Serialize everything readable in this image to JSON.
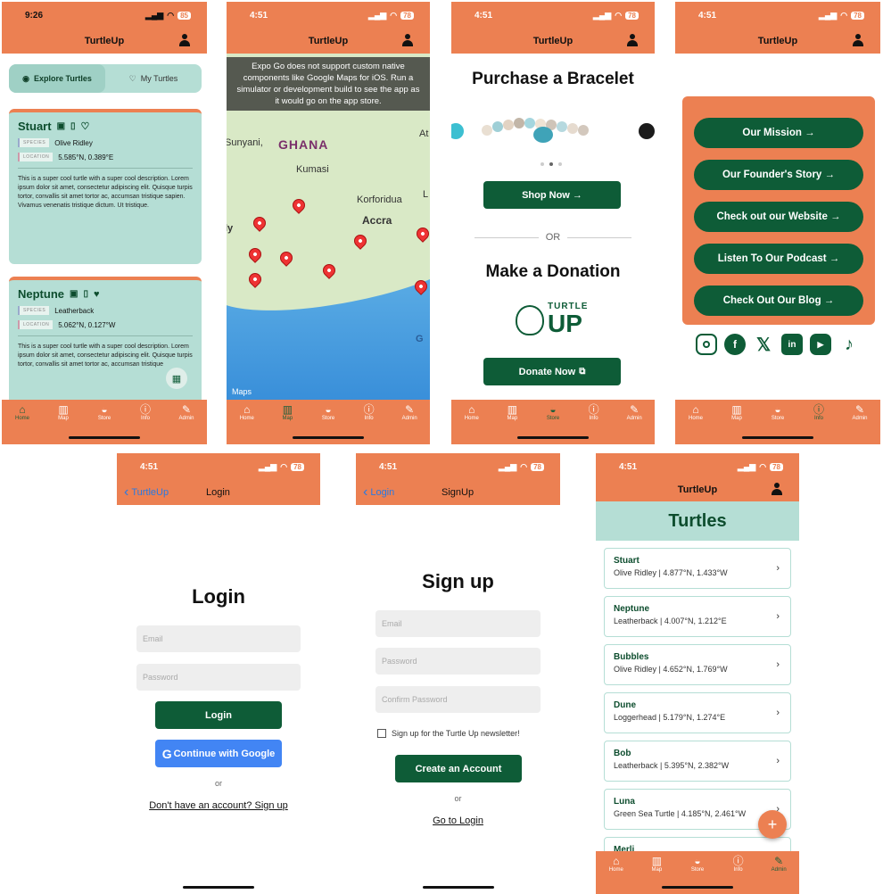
{
  "colors": {
    "primary_orange": "#EC8052",
    "dark_green": "#0E5C37",
    "mint": "#B5DED5",
    "google_blue": "#4285F4"
  },
  "tabs": [
    {
      "label": "Home",
      "icon": "home-icon"
    },
    {
      "label": "Map",
      "icon": "map-icon"
    },
    {
      "label": "Store",
      "icon": "basket-icon"
    },
    {
      "label": "Info",
      "icon": "info-icon"
    },
    {
      "label": "Admin",
      "icon": "wrench-icon"
    }
  ],
  "phone1": {
    "time": "9:26",
    "battery": "85",
    "title": "TurtleUp",
    "seg_explore": "Explore Turtles",
    "seg_my": "My Turtles",
    "species_pill": "SPECIES",
    "location_pill": "LOCATION",
    "cards": [
      {
        "name": "Stuart",
        "species": "Olive Ridley",
        "location": "5.585°N, 0.389°E",
        "desc": "This is a super cool turtle with a super cool description. Lorem ipsum dolor sit amet, consectetur adipiscing elit. Quisque turpis tortor, convallis sit amet tortor ac, accumsan tristique sapien. Vivamus venenatis tristique dictum. Ut tristique."
      },
      {
        "name": "Neptune",
        "species": "Leatherback",
        "location": "5.062°N, 0.127°W",
        "desc": "This is a super cool turtle with a super cool description. Lorem ipsum dolor sit amet, consectetur adipiscing elit. Quisque turpis tortor, convallis sit amet tortor ac, accumsan tristique"
      }
    ]
  },
  "phone2": {
    "time": "4:51",
    "battery": "78",
    "title": "TurtleUp",
    "banner": "Expo Go does not support custom native components like Google Maps for iOS. Run a simulator or development build to see the app as it would go on the app store.",
    "labels": {
      "ghana": "GHANA",
      "kumasi": "Kumasi",
      "sunyani": "Sunyani,",
      "accra": "Accra",
      "korforidua": "Korforidua",
      "at": "At",
      "l": "L",
      "ly": "ly",
      "g": "G"
    },
    "apple_maps": "Maps"
  },
  "phone3": {
    "time": "4:51",
    "battery": "78",
    "title": "TurtleUp",
    "purchase_title": "Purchase a Bracelet",
    "shop_button": "Shop Now →",
    "or": "OR",
    "donate_title": "Make a Donation",
    "logo_top": "TURTLE",
    "logo_bottom": "UP",
    "donate_button": "Donate Now"
  },
  "phone4": {
    "time": "4:51",
    "battery": "78",
    "title": "TurtleUp",
    "buttons": [
      "Our Mission →",
      "Our Founder's Story →",
      "Check out our Website →",
      "Listen To Our Podcast →",
      "Check Out Our Blog →"
    ],
    "socials": [
      "instagram-icon",
      "facebook-icon",
      "x-icon",
      "linkedin-icon",
      "youtube-icon",
      "tiktok-icon"
    ]
  },
  "login": {
    "time": "4:51",
    "battery": "78",
    "back": "TurtleUp",
    "nav_title": "Login",
    "heading": "Login",
    "email_ph": "Email",
    "password_ph": "Password",
    "login_button": "Login",
    "google_button": "Continue with Google",
    "or": "or",
    "signup_link": "Don't have an account? Sign up"
  },
  "signup": {
    "time": "4:51",
    "battery": "78",
    "back": "Login",
    "nav_title": "SignUp",
    "heading": "Sign up",
    "email_ph": "Email",
    "password_ph": "Password",
    "confirm_ph": "Confirm Password",
    "newsletter": "Sign up for the Turtle Up newsletter!",
    "create_button": "Create an Account",
    "or": "or",
    "login_link": "Go to Login"
  },
  "admin": {
    "time": "4:51",
    "battery": "78",
    "title": "TurtleUp",
    "heading": "Turtles",
    "items": [
      {
        "name": "Stuart",
        "sub": "Olive Ridley | 4.877°N, 1.433°W"
      },
      {
        "name": "Neptune",
        "sub": "Leatherback | 4.007°N, 1.212°E"
      },
      {
        "name": "Bubbles",
        "sub": "Olive Ridley | 4.652°N, 1.769°W"
      },
      {
        "name": "Dune",
        "sub": "Loggerhead | 5.179°N, 1.274°E"
      },
      {
        "name": "Bob",
        "sub": "Leatherback | 5.395°N, 2.382°W"
      },
      {
        "name": "Luna",
        "sub": "Green Sea Turtle | 4.185°N, 2.461°W"
      }
    ],
    "partial_item": "Merli",
    "fab": "+"
  }
}
